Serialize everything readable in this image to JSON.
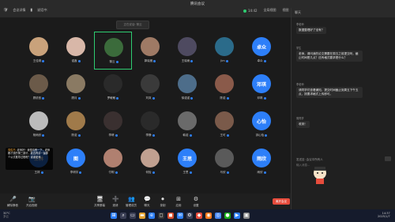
{
  "app": {
    "title": "腾讯会议"
  },
  "topbar": {
    "left_items": [
      "会议详情",
      "说话中:"
    ],
    "time_label": "14:42",
    "tr_items": [
      "全局视图",
      "视图",
      "退出全屏",
      "发言人"
    ],
    "meeting_icons": [
      "shield-icon",
      "signal-icon",
      "info-icon",
      "record-icon"
    ]
  },
  "grid": {
    "search_placeholder": "正在说话: 黎云",
    "tiles": [
      {
        "name": "王佳琪",
        "color": "#c9a27b"
      },
      {
        "name": "诺鑫",
        "color": "#d8b7a8"
      },
      {
        "name": "黎云",
        "color": "#3b6b3b",
        "active": true
      },
      {
        "name": "郭晓雅",
        "color": "#9f7a65"
      },
      {
        "name": "王晓雨",
        "color": "#4e4a60"
      },
      {
        "name": "Jim",
        "color": "#2b6b8a"
      },
      {
        "name": "卓众",
        "color": "#2d7ff9",
        "text": "卓众"
      },
      {
        "name": "顾依依",
        "color": "#6b5a49"
      },
      {
        "name": "顾月",
        "color": "#8a7a63"
      },
      {
        "name": "罗敏敏",
        "color": "#2a2a2a"
      },
      {
        "name": "刘岚",
        "color": "#3a3a3a"
      },
      {
        "name": "徐诺诺",
        "color": "#4d6d8a"
      },
      {
        "name": "陈诺",
        "color": "#8a5a4a"
      },
      {
        "name": "邓琪",
        "color": "#2d7ff9",
        "text": "邓琪"
      },
      {
        "name": "杨雨欣",
        "color": "#bbb"
      },
      {
        "name": "陈诺",
        "color": "#a07a4a"
      },
      {
        "name": "李晴",
        "color": "#3a3030"
      },
      {
        "name": "李静",
        "color": "#2a2a2a"
      },
      {
        "name": "韩诺",
        "color": "#6a6a6a"
      },
      {
        "name": "王可",
        "color": "#7a5a4a"
      },
      {
        "name": "钟心怡",
        "color": "#2d7ff9",
        "text": "心怡"
      },
      {
        "name": "王林",
        "color": "#2d7ff9",
        "text": "王林"
      },
      {
        "name": "李明宇",
        "color": "#2d7ff9",
        "text": "图"
      },
      {
        "name": "付明",
        "color": "#b08070"
      },
      {
        "name": "何怡",
        "color": "#c0a090"
      },
      {
        "name": "王思",
        "color": "#2d7ff9",
        "text": "王思"
      },
      {
        "name": "马欣",
        "color": "#5a5a5a"
      },
      {
        "name": "雨欣",
        "color": "#2d7ff9",
        "text": "雨欣"
      }
    ]
  },
  "overlay": {
    "sender": "周俊杰:",
    "text": "老师好！我想请教一下，老师刚才说的第三部分，能否再讲一遍那个公式推导过程呢？谢谢老师"
  },
  "chat": {
    "header": "聊天",
    "messages": [
      {
        "sender": "李老师",
        "text": "数据整理好了没有？"
      },
      {
        "sender": "学生",
        "text": "老师，请问我的论文需要在周五之前提交吗，截止时间是几点？还有格式要求是什么？"
      },
      {
        "sender": "李老师",
        "text": "请同学们查看通知，提交时间截止到周五下午五点，按要求格式上传即可。"
      },
      {
        "sender": "周同学",
        "text": "收到！"
      }
    ],
    "send_to_label": "发送至: 会议中所有人",
    "input_placeholder": "输入消息..."
  },
  "controls": {
    "items": [
      {
        "label": "解除静音",
        "icon": "🎤"
      },
      {
        "label": "开启视频",
        "icon": "📷"
      },
      {
        "label": "共享屏幕",
        "icon": "🖥"
      },
      {
        "label": "邀请",
        "icon": "➕"
      },
      {
        "label": "管理成员",
        "icon": "👥"
      },
      {
        "label": "聊天",
        "icon": "💬"
      },
      {
        "label": "录制",
        "icon": "⏺"
      },
      {
        "label": "应用",
        "icon": "⊞"
      },
      {
        "label": "设置",
        "icon": "⚙"
      }
    ],
    "leave_label": "离开会议"
  },
  "taskbar": {
    "weather": "30°C",
    "weather_sub": "多云",
    "clock_time": "14:37",
    "clock_date": "2025/1/7"
  }
}
